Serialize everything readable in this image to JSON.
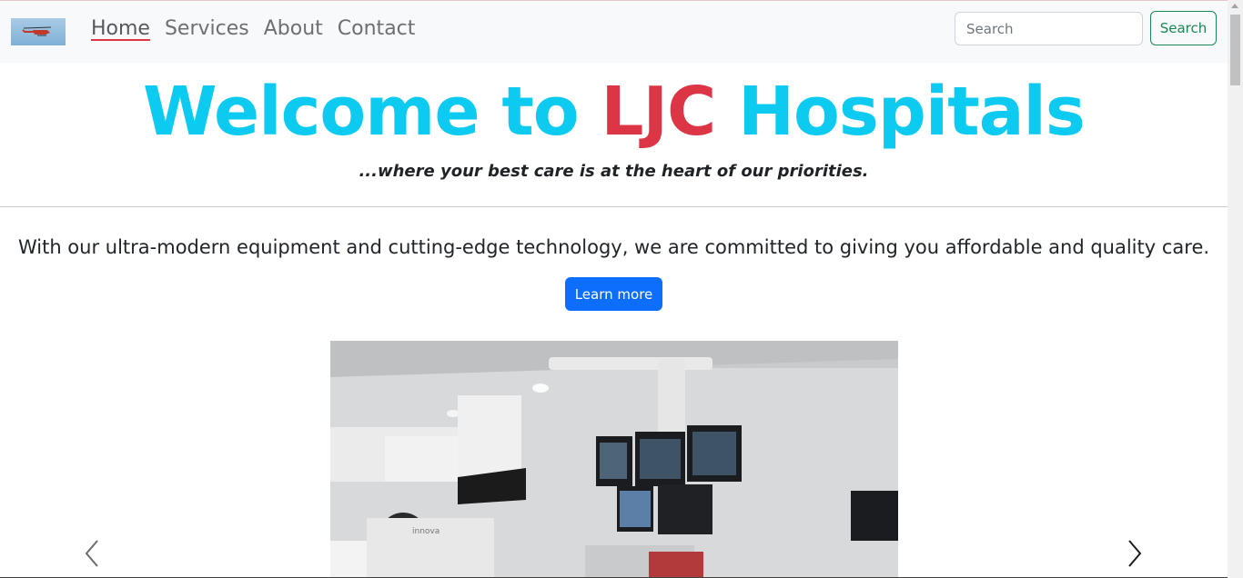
{
  "navbar": {
    "logo_alt": "logo",
    "links": [
      {
        "label": "Home",
        "active": true
      },
      {
        "label": "Services"
      },
      {
        "label": "About"
      },
      {
        "label": "Contact"
      }
    ],
    "search": {
      "placeholder": "Search",
      "button_label": "Search"
    }
  },
  "hero": {
    "title_before": "Welcome to ",
    "title_accent": "LJC",
    "title_after": " Hospitals",
    "tagline": "...where your best care is at the heart of our priorities.",
    "title_color": "#0dcaf0",
    "accent_color": "#dc3545"
  },
  "intro": {
    "text": "With our ultra-modern equipment and cutting-edge technology, we are committed to giving you affordable and quality care.",
    "button_label": "Learn more"
  },
  "carousel": {
    "prev_icon": "chevron-left-icon",
    "next_icon": "chevron-right-icon",
    "image_description_label": "innova"
  }
}
